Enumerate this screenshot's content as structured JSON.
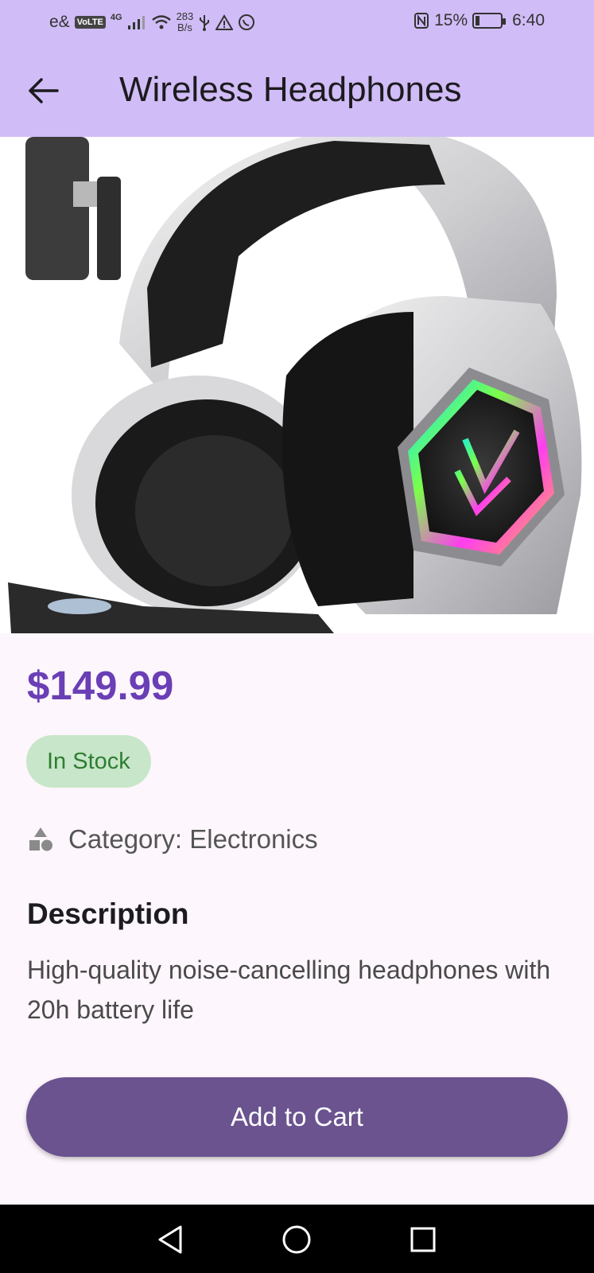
{
  "status_bar": {
    "carrier": "e&",
    "volte": "VoLTE",
    "network": "4G",
    "speed_value": "283",
    "speed_unit": "B/s",
    "battery": "15%",
    "battery_level": 0.15,
    "time": "6:40",
    "icons": [
      "signal-icon",
      "wifi-icon",
      "usb-icon",
      "warning-icon",
      "whatsapp-icon",
      "nfc-icon",
      "battery-icon"
    ]
  },
  "app_bar": {
    "title": "Wireless Headphones",
    "back_icon": "arrow-back-icon"
  },
  "product": {
    "image": "headphones-photo",
    "price": "$149.99",
    "stock": "In Stock",
    "category": "Category: Electronics",
    "category_icon": "category-icon",
    "description_heading": "Description",
    "description": "High-quality noise-cancelling headphones with 20h battery life"
  },
  "actions": {
    "add_to_cart": "Add to Cart"
  },
  "nav_bar": {
    "icons": [
      "back-triangle-icon",
      "home-circle-icon",
      "recents-square-icon"
    ]
  },
  "colors": {
    "header": "#d0bcf6",
    "price": "#6a3fb5",
    "chip_bg": "#c8e6c9",
    "chip_text": "#2e7d32",
    "button": "#6a538f",
    "background": "#fdf6fc"
  }
}
